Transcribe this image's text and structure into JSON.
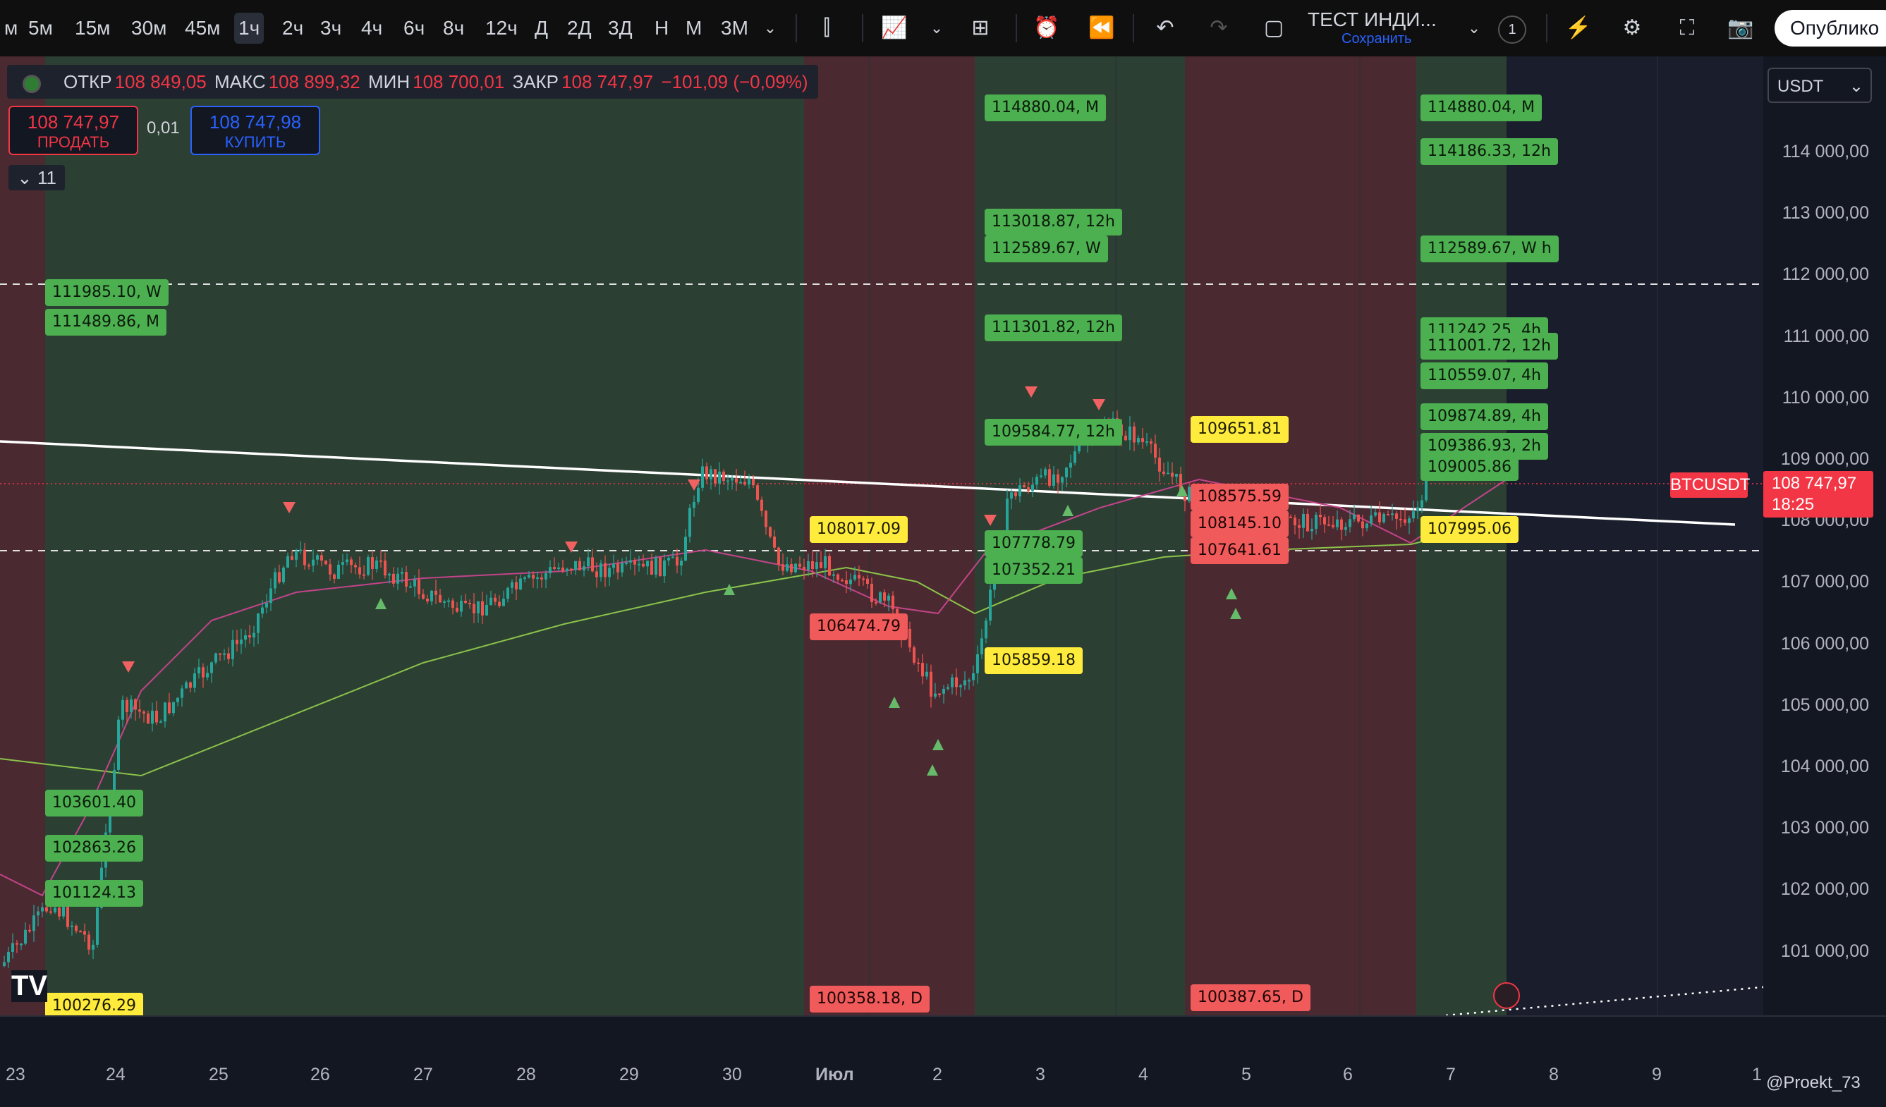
{
  "toolbar": {
    "timeframes": [
      "м",
      "5м",
      "15м",
      "30м",
      "45м",
      "1ч",
      "2ч",
      "3ч",
      "4ч",
      "6ч",
      "8ч",
      "12ч",
      "Д",
      "2Д",
      "3Д",
      "Н",
      "М",
      "3М"
    ],
    "active_timeframe": "1ч",
    "template_name": "ТЕСТ ИНДИ...",
    "template_save": "Сохранить",
    "alerts_badge": "1",
    "publish_label": "Опублико"
  },
  "legend": {
    "open_label": "ОТКР",
    "open": "108 849,05",
    "high_label": "МАКС",
    "high": "108 899,32",
    "low_label": "МИН",
    "low": "108 700,01",
    "close_label": "ЗАКР",
    "close": "108 747,97",
    "change": "−101,09 (−0,09%)"
  },
  "trade": {
    "sell_price": "108 747,97",
    "sell_label": "ПРОДАТЬ",
    "buy_price": "108 747,98",
    "buy_label": "КУПИТЬ",
    "quantity": "0,01",
    "indicators_count": "11"
  },
  "currency": "USDT",
  "price_axis": [
    "114 000,00",
    "113 000,00",
    "112 000,00",
    "111 000,00",
    "110 000,00",
    "109 000,00",
    "108 000,00",
    "107 000,00",
    "106 000,00",
    "105 000,00",
    "104 000,00",
    "103 000,00",
    "102 000,00",
    "101 000,00"
  ],
  "time_axis": [
    "23",
    "24",
    "25",
    "26",
    "27",
    "28",
    "29",
    "30",
    "Июл",
    "2",
    "3",
    "4",
    "5",
    "6",
    "7",
    "8",
    "9",
    "1"
  ],
  "current": {
    "symbol": "BTCUSDT",
    "price": "108 747,97",
    "countdown": "18:25"
  },
  "watermark": "@Proekt_73",
  "colors": {
    "bull": "#26a69a",
    "bear": "#ef5350",
    "green_zone": "#2c3f33",
    "red_zone": "#4a2a30",
    "dark_zone": "#1a1d2b"
  },
  "levels": [
    {
      "text": "111985.10, W",
      "style": "g"
    },
    {
      "text": "111489.86, M",
      "style": "g"
    },
    {
      "text": "103601.40",
      "style": "g"
    },
    {
      "text": "102863.26",
      "style": "g"
    },
    {
      "text": "101124.13",
      "style": "g"
    },
    {
      "text": "100276.29",
      "style": "y"
    },
    {
      "text": "108017.09",
      "style": "y"
    },
    {
      "text": "106474.79",
      "style": "r"
    },
    {
      "text": "100358.18, D",
      "style": "r"
    },
    {
      "text": "114880.04, M",
      "style": "g"
    },
    {
      "text": "113018.87, 12h",
      "style": "g"
    },
    {
      "text": "112589.67, W",
      "style": "g"
    },
    {
      "text": "111301.82, 12h",
      "style": "g"
    },
    {
      "text": "109584.77, 12h",
      "style": "g"
    },
    {
      "text": "107778.79",
      "style": "g"
    },
    {
      "text": "107352.21",
      "style": "g"
    },
    {
      "text": "105859.18",
      "style": "y"
    },
    {
      "text": "109651.81",
      "style": "y"
    },
    {
      "text": "108575.59",
      "style": "r"
    },
    {
      "text": "108145.10",
      "style": "r"
    },
    {
      "text": "107641.61",
      "style": "r"
    },
    {
      "text": "100387.65, D",
      "style": "r"
    },
    {
      "text": "114880.04, M",
      "style": "g"
    },
    {
      "text": "114186.33, 12h",
      "style": "g"
    },
    {
      "text": "112589.67, W h",
      "style": "g"
    },
    {
      "text": "111242.25, 4h",
      "style": "g"
    },
    {
      "text": "111001.72, 12h",
      "style": "g"
    },
    {
      "text": "110559.07, 4h",
      "style": "g"
    },
    {
      "text": "109874.89, 4h",
      "style": "g"
    },
    {
      "text": "109386.93, 2h",
      "style": "g"
    },
    {
      "text": "109005.86",
      "style": "g"
    },
    {
      "text": "107995.06",
      "style": "y"
    }
  ]
}
